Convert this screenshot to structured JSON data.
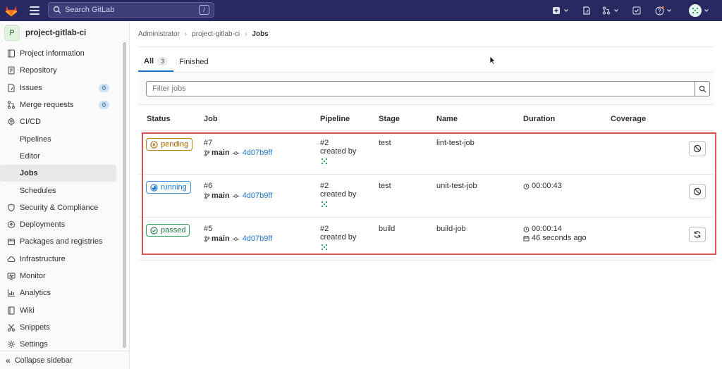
{
  "topbar": {
    "search_placeholder": "Search GitLab",
    "search_shortcut": "/"
  },
  "sidebar": {
    "project_initial": "P",
    "project_name": "project-gitlab-ci",
    "items": [
      {
        "label": "Project information",
        "icon": "info-icon"
      },
      {
        "label": "Repository",
        "icon": "doc-icon"
      },
      {
        "label": "Issues",
        "icon": "issues-icon",
        "badge": "0"
      },
      {
        "label": "Merge requests",
        "icon": "merge-icon",
        "badge": "0"
      },
      {
        "label": "CI/CD",
        "icon": "rocket-icon"
      },
      {
        "label": "Pipelines",
        "sub": true
      },
      {
        "label": "Editor",
        "sub": true
      },
      {
        "label": "Jobs",
        "sub": true,
        "active": true
      },
      {
        "label": "Schedules",
        "sub": true
      },
      {
        "label": "Security & Compliance",
        "icon": "shield-icon"
      },
      {
        "label": "Deployments",
        "icon": "deploy-icon"
      },
      {
        "label": "Packages and registries",
        "icon": "package-icon"
      },
      {
        "label": "Infrastructure",
        "icon": "cloud-icon"
      },
      {
        "label": "Monitor",
        "icon": "monitor-icon"
      },
      {
        "label": "Analytics",
        "icon": "chart-icon"
      },
      {
        "label": "Wiki",
        "icon": "book-icon"
      },
      {
        "label": "Snippets",
        "icon": "scissors-icon"
      },
      {
        "label": "Settings",
        "icon": "settings-icon"
      }
    ],
    "collapse_label": "Collapse sidebar"
  },
  "breadcrumb": {
    "items": [
      "Administrator",
      "project-gitlab-ci",
      "Jobs"
    ]
  },
  "tabs": {
    "all_label": "All",
    "all_count": "3",
    "finished_label": "Finished"
  },
  "filter": {
    "placeholder": "Filter jobs"
  },
  "table": {
    "headers": {
      "status": "Status",
      "job": "Job",
      "pipeline": "Pipeline",
      "stage": "Stage",
      "name": "Name",
      "duration": "Duration",
      "coverage": "Coverage"
    },
    "rows": [
      {
        "status": "pending",
        "job_id": "#7",
        "branch": "main",
        "sha": "4d07b9ff",
        "pipeline_id": "#2",
        "created_by": "created by",
        "stage": "test",
        "name": "lint-test-job",
        "duration": "",
        "finished": "",
        "action": "cancel",
        "status_color": "#ab6100"
      },
      {
        "status": "running",
        "job_id": "#6",
        "branch": "main",
        "sha": "4d07b9ff",
        "pipeline_id": "#2",
        "created_by": "created by",
        "stage": "test",
        "name": "unit-test-job",
        "duration": "00:00:43",
        "finished": "",
        "action": "cancel",
        "status_color": "#1f75cb"
      },
      {
        "status": "passed",
        "job_id": "#5",
        "branch": "main",
        "sha": "4d07b9ff",
        "pipeline_id": "#2",
        "created_by": "created by",
        "stage": "build",
        "name": "build-job",
        "duration": "00:00:14",
        "finished": "46 seconds ago",
        "action": "retry",
        "status_color": "#217645"
      }
    ]
  }
}
